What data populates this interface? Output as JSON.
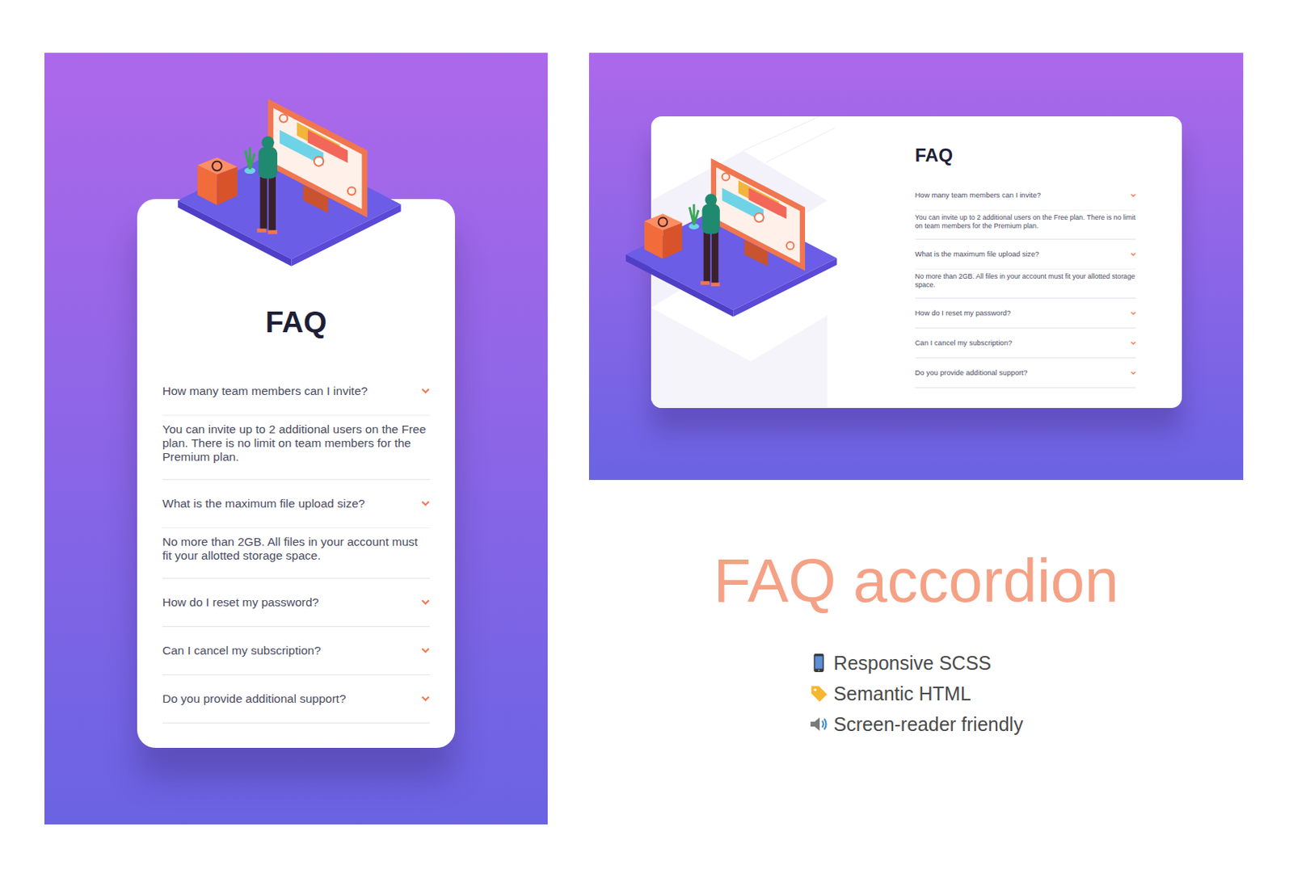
{
  "mobile": {
    "title": "FAQ",
    "items": [
      {
        "question": "How many team members can I invite?",
        "answer": "You can invite up to 2 additional users on the Free plan. There is no limit on team members for the Premium plan.",
        "expanded": true
      },
      {
        "question": "What is the maximum file upload size?",
        "answer": "No more than 2GB. All files in your account must fit your allotted storage space.",
        "expanded": true
      },
      {
        "question": "How do I reset my password?",
        "answer": "",
        "expanded": false
      },
      {
        "question": "Can I cancel my subscription?",
        "answer": "",
        "expanded": false
      },
      {
        "question": "Do you provide additional support?",
        "answer": "",
        "expanded": false
      }
    ]
  },
  "desktop": {
    "title": "FAQ",
    "items": [
      {
        "question": "How many team members can I invite?",
        "answer": "You can invite up to 2 additional users on the Free plan. There is no limit on team members for the Premium plan.",
        "expanded": true
      },
      {
        "question": "What is the maximum file upload size?",
        "answer": "No more than 2GB. All files in your account must fit your allotted storage space.",
        "expanded": true
      },
      {
        "question": "How do I reset my password?",
        "answer": "",
        "expanded": false
      },
      {
        "question": "Can I cancel my subscription?",
        "answer": "",
        "expanded": false
      },
      {
        "question": "Do you provide additional support?",
        "answer": "",
        "expanded": false
      }
    ]
  },
  "project_title": "FAQ accordion",
  "features": [
    {
      "label": "Responsive SCSS"
    },
    {
      "label": "Semantic HTML"
    },
    {
      "label": "Screen-reader friendly"
    }
  ]
}
